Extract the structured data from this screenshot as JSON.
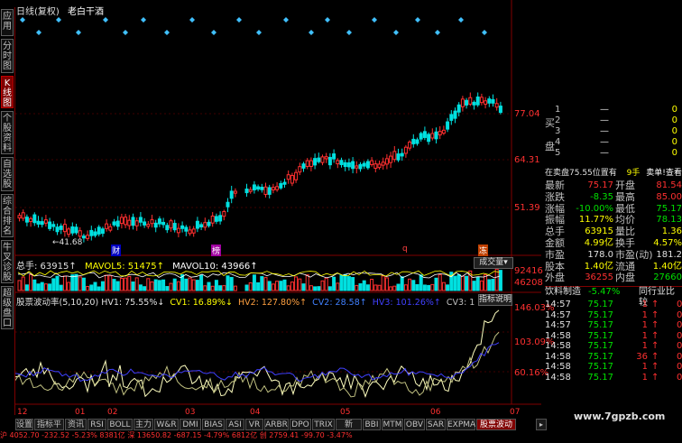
{
  "header": {
    "title": "日线(复权)",
    "stock_name": "老白干酒"
  },
  "left_tabs": [
    "应用",
    "分时图",
    "K线图",
    "个股资料",
    "自选股",
    "综合排名",
    "牛叉诊股",
    "超级盘口"
  ],
  "price_axis": [
    "77.04",
    "64.31",
    "51.39"
  ],
  "low_label": "←41.68",
  "event_markers": [
    "财",
    "榜",
    "q",
    "冻"
  ],
  "volume_header": {
    "total": "总手: 63915↑",
    "mavol5": "MAVOL5: 51475↑",
    "mavol10": "MAVOL10: 43966↑",
    "dropdown": "成交量"
  },
  "volume_axis": [
    "92416",
    "46208"
  ],
  "indicator_header": {
    "name": "股票波动率(5,10,20)",
    "hv1": "HV1: 75.55%↓",
    "cv1": "CV1: 16.89%↓",
    "hv2": "HV2: 127.80%↑",
    "cv2": "CV2: 28.58↑",
    "hv3": "HV3: 101.26%↑",
    "cv3": "CV3: 1",
    "help": "指标说明"
  },
  "indicator_axis": [
    "146.03%",
    "103.09%",
    "60.16%"
  ],
  "x_axis": [
    "12",
    "01",
    "02",
    "03",
    "04",
    "05",
    "06",
    "07"
  ],
  "orderbook": {
    "sell_label": "卖盘",
    "buy_label": "买",
    "sell_rows": [
      {
        "n": "1",
        "price": "—",
        "vol": "0"
      },
      {
        "n": "2",
        "price": "—",
        "vol": "0"
      },
      {
        "n": "3",
        "price": "—",
        "vol": "0"
      },
      {
        "n": "4",
        "price": "—",
        "vol": "0"
      },
      {
        "n": "5",
        "price": "—",
        "vol": "0"
      }
    ],
    "status": "在卖盘75.55位置有",
    "status_vol": "9手",
    "status_link": "卖单!查看详细"
  },
  "quote": [
    {
      "l1": "最新",
      "v1": "75.17",
      "c1": "red",
      "l2": "开盘",
      "v2": "81.54",
      "c2": "red"
    },
    {
      "l1": "涨跌",
      "v1": "-8.35",
      "c1": "green",
      "l2": "最高",
      "v2": "85.00",
      "c2": "red"
    },
    {
      "l1": "涨幅",
      "v1": "-10.00%",
      "c1": "green",
      "l2": "最低",
      "v2": "75.17",
      "c2": "green"
    },
    {
      "l1": "振幅",
      "v1": "11.77%",
      "c1": "yellow",
      "l2": "均价",
      "v2": "78.13",
      "c2": "green"
    },
    {
      "l1": "总手",
      "v1": "63915",
      "c1": "yellow",
      "l2": "量比",
      "v2": "1.36",
      "c2": "yellow"
    },
    {
      "l1": "金额",
      "v1": "4.99亿",
      "c1": "yellow",
      "l2": "换手",
      "v2": "4.57%",
      "c2": "yellow"
    },
    {
      "l1": "市盈",
      "v1": "178.0",
      "c1": "white",
      "l2": "市盈(动)",
      "v2": "181.2",
      "c2": "white"
    },
    {
      "l1": "股本",
      "v1": "1.40亿",
      "c1": "yellow",
      "l2": "流通",
      "v2": "1.40亿",
      "c2": "yellow"
    },
    {
      "l1": "外盘",
      "v1": "36255",
      "c1": "red",
      "l2": "内盘",
      "v2": "27660",
      "c2": "green"
    }
  ],
  "industry": {
    "name": "饮料制造",
    "pct": "-5.47%",
    "link": "同行业比较"
  },
  "trades": [
    {
      "t": "14:57",
      "p": "75.17",
      "v": "1",
      "d": "↑"
    },
    {
      "t": "14:57",
      "p": "75.17",
      "v": "1",
      "d": "↑"
    },
    {
      "t": "14:57",
      "p": "75.17",
      "v": "1",
      "d": "↑"
    },
    {
      "t": "14:58",
      "p": "75.17",
      "v": "1",
      "d": "↑"
    },
    {
      "t": "14:58",
      "p": "75.17",
      "v": "1",
      "d": "↑"
    },
    {
      "t": "14:58",
      "p": "75.17",
      "v": "36",
      "d": "↑"
    },
    {
      "t": "14:58",
      "p": "75.17",
      "v": "1",
      "d": "↑"
    },
    {
      "t": "14:58",
      "p": "75.17",
      "v": "1",
      "d": "↑"
    }
  ],
  "bottom_tabs": [
    "设置",
    "指标平台",
    "资讯",
    "RSI",
    "BOLL",
    "主力",
    "W&R",
    "DMI",
    "BIAS",
    "ASI",
    "VR",
    "ARBR",
    "DPO",
    "TRIX",
    "新DMA",
    "BBI",
    "MTM",
    "OBV",
    "SAR",
    "EXPMA",
    "股票波动率"
  ],
  "watermark": "www.7gpzb.com",
  "ticker": "沪 4052.70 -232.52 -5.23% 8381亿 深 13650.82 -687.15 -4.79% 6812亿 创 2759.41 -99.70 -3.47%",
  "colors": {
    "up": "#ff3030",
    "down": "#00e0e0",
    "hv": "#ffffc0",
    "cv": "#4040ff",
    "border": "#800000"
  }
}
